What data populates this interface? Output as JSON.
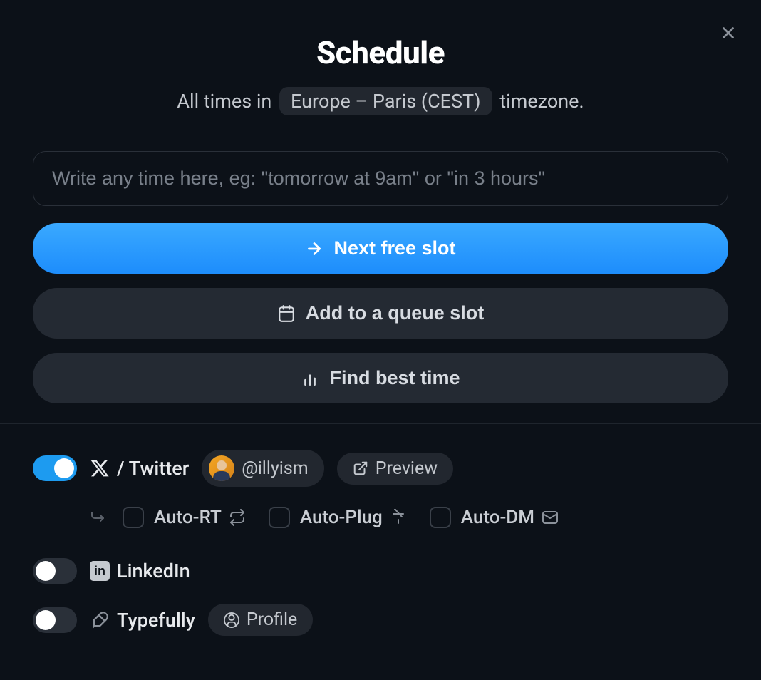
{
  "header": {
    "title": "Schedule",
    "subtitle_prefix": "All times in",
    "timezone": "Europe – Paris (CEST)",
    "subtitle_suffix": "timezone."
  },
  "input": {
    "placeholder": "Write any time here, eg: \"tomorrow at 9am\" or \"in 3 hours\""
  },
  "buttons": {
    "next_slot": "Next free slot",
    "queue_slot": "Add to a queue slot",
    "best_time": "Find best time"
  },
  "platforms": {
    "twitter": {
      "label": "/ Twitter",
      "handle": "@illyism",
      "preview": "Preview",
      "enabled": true,
      "options": {
        "auto_rt": "Auto-RT",
        "auto_plug": "Auto-Plug",
        "auto_dm": "Auto-DM"
      }
    },
    "linkedin": {
      "label": "LinkedIn",
      "enabled": false
    },
    "typefully": {
      "label": "Typefully",
      "profile": "Profile",
      "enabled": false
    }
  }
}
